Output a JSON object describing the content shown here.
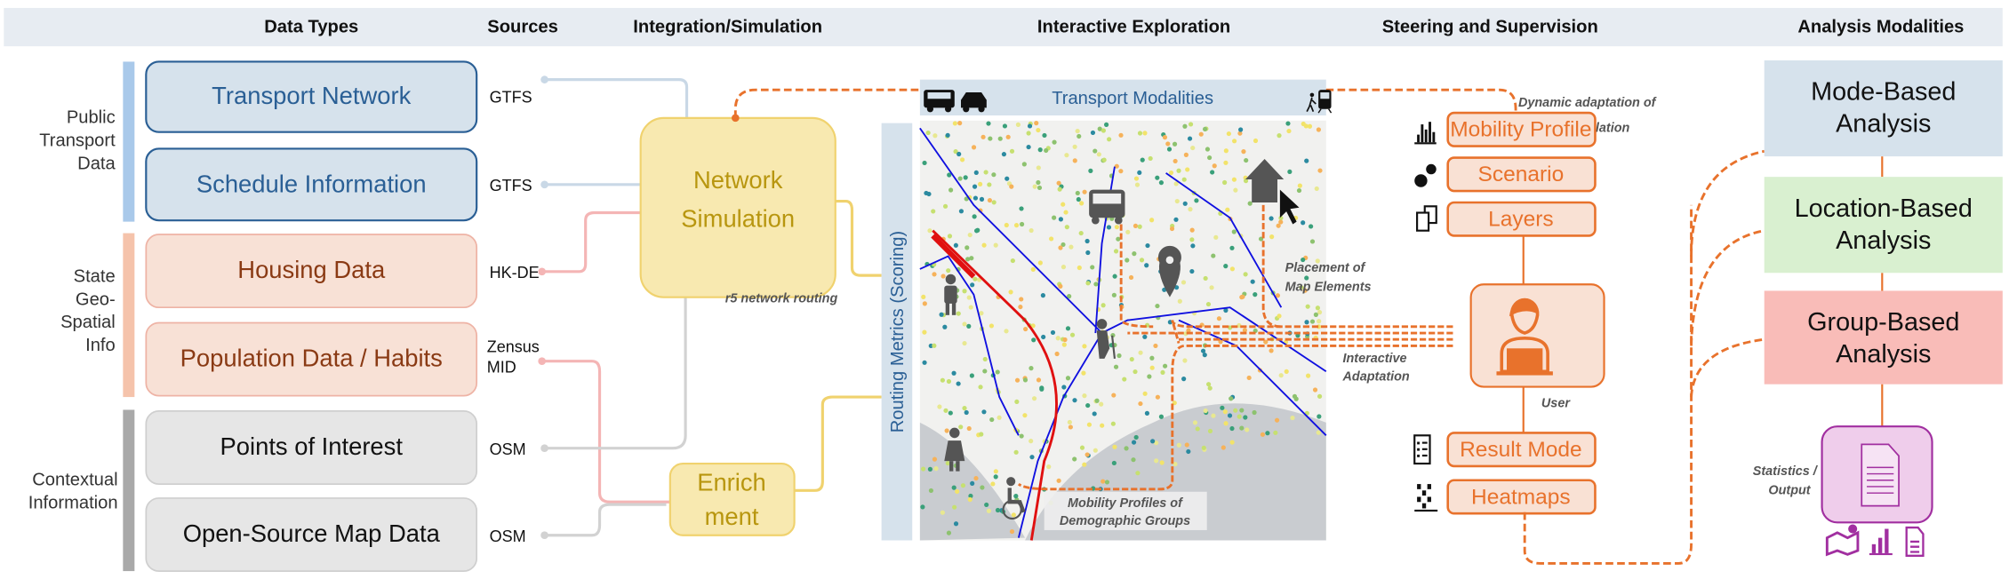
{
  "header": {
    "columns": [
      "Data Types",
      "Sources",
      "Integration/Simulation",
      "Interactive Exploration",
      "Steering and Supervision",
      "Analysis Modalities"
    ]
  },
  "groups": [
    {
      "label_lines": [
        "Public",
        "Transport",
        "Data"
      ],
      "color": "#a9c9ea"
    },
    {
      "label_lines": [
        "State",
        "Geo-",
        "Spatial",
        "Info"
      ],
      "color": "#f5c3ab"
    },
    {
      "label_lines": [
        "Contextual",
        "Information"
      ],
      "color": "#a9a9a9"
    }
  ],
  "data_types": [
    {
      "label": "Transport Network",
      "source": "GTFS"
    },
    {
      "label": "Schedule Information",
      "source": "GTFS"
    },
    {
      "label": "Housing Data",
      "source": "HK-DE"
    },
    {
      "label": "Population Data / Habits",
      "source_lines": [
        "Zensus",
        "MID"
      ]
    },
    {
      "label": "Points of Interest",
      "source": "OSM"
    },
    {
      "label": "Open-Source Map Data",
      "source": "OSM"
    }
  ],
  "integration": {
    "network_simulation": [
      "Network",
      "Simulation"
    ],
    "routing_note": "r5 network routing",
    "enrichment": [
      "Enrich",
      "ment"
    ]
  },
  "exploration": {
    "routing_metrics": "Routing Metrics (Scoring)",
    "transport_modalities": "Transport Modalities",
    "annotations": {
      "dynamic_adaptation": [
        "Dynamic adaptation of",
        "simulation"
      ],
      "placement": [
        "Placement of",
        "Map Elements"
      ],
      "interactive_adaptation": [
        "Interactive",
        "Adaptation"
      ],
      "mobility_profiles": [
        "Mobility Profiles of",
        "Demographic Groups"
      ]
    }
  },
  "steering": {
    "buttons": [
      {
        "label": "Mobility Profile",
        "icon": "bar-chart-icon"
      },
      {
        "label": "Scenario",
        "icon": "gears-icon"
      },
      {
        "label": "Layers",
        "icon": "layers-icon"
      },
      {
        "label": "Result Mode",
        "icon": "list-icon"
      },
      {
        "label": "Heatmaps",
        "icon": "heatmap-icon"
      }
    ],
    "user_label": "User",
    "accent": "#e8722c"
  },
  "analysis": {
    "modes": [
      {
        "lines": [
          "Mode-Based",
          "Analysis"
        ],
        "color": "#d6e2ec"
      },
      {
        "lines": [
          "Location-Based",
          "Analysis"
        ],
        "color": "#d9f0d0"
      },
      {
        "lines": [
          "Group-Based",
          "Analysis"
        ],
        "color": "#f9bcb8"
      }
    ],
    "output_label": [
      "Statistics /",
      "Output"
    ],
    "output_icons": [
      "map-icon",
      "chart-icon",
      "document-icon"
    ]
  }
}
